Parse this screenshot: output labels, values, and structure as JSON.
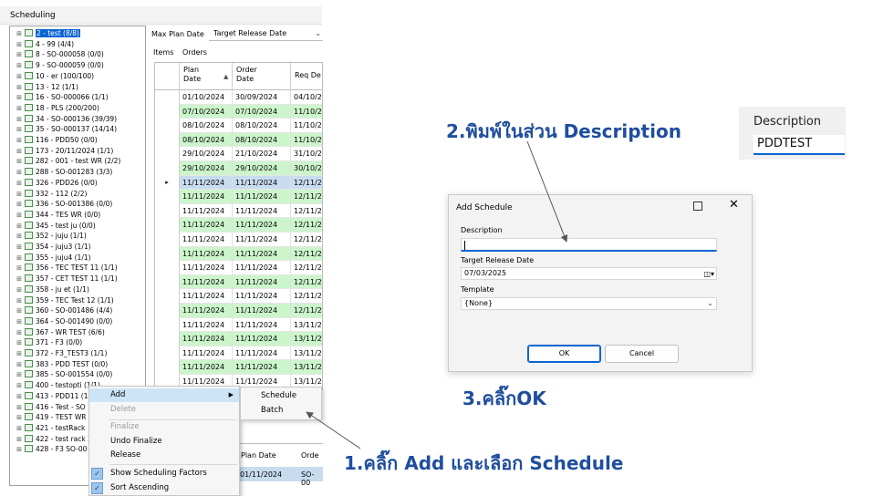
{
  "app": {
    "title": "Scheduling",
    "tree_items": [
      "2 - test (8/8)",
      "4 - 99 (4/4)",
      "8 - SO-000058 (0/0)",
      "9 - SO-000059 (0/0)",
      "10 - er (100/100)",
      "13 - 12 (1/1)",
      "16 - SO-000066 (1/1)",
      "18 - PLS (200/200)",
      "34 - SO-000136 (39/39)",
      "35 - SO-000137 (14/14)",
      "116 - PDD50 (0/0)",
      "173 - 20/11/2024 (1/1)",
      "282 - 001 - test WR (2/2)",
      "288 - SO-001283 (3/3)",
      "326 - PDD26 (0/0)",
      "332 - 112 (2/2)",
      "336 - SO-001386 (0/0)",
      "344 - TES WR (0/0)",
      "345 - test ju (0/0)",
      "352 - juju (1/1)",
      "354 - juju3 (1/1)",
      "355 - juju4 (1/1)",
      "356 - TEC TEST 11 (1/1)",
      "357 - CET TEST 11 (1/1)",
      "358 - ju et (1/1)",
      "359 - TEC Test 12 (1/1)",
      "360 - SO-001486 (4/4)",
      "364 - SO-001490 (0/0)",
      "367 - WR TEST (6/6)",
      "371 - F3 (0/0)",
      "372 - F3_TEST3 (1/1)",
      "383 - PDD TEST (0/0)",
      "385 - SO-001554 (0/0)",
      "400 - testopti (1/1)",
      "413 - PDD11 (1",
      "416 - Test - SO",
      "419 - TEST WR",
      "421 - testRack",
      "422 - test rack 2",
      "428 - F3 SO-00"
    ],
    "filter_label": "Max Plan Date",
    "filter_value": "Target Release Date",
    "grid_tabs": [
      "Items",
      "Orders"
    ],
    "grid_headers": [
      "Plan\nDate",
      "Order\nDate",
      "Req De"
    ],
    "grid_rows": [
      [
        "01/10/2024",
        "30/09/2024",
        "04/10/2"
      ],
      [
        "07/10/2024",
        "07/10/2024",
        "11/10/2"
      ],
      [
        "08/10/2024",
        "08/10/2024",
        "11/10/2"
      ],
      [
        "08/10/2024",
        "08/10/2024",
        "11/10/2"
      ],
      [
        "29/10/2024",
        "21/10/2024",
        "31/10/2"
      ],
      [
        "29/10/2024",
        "29/10/2024",
        "30/10/2"
      ],
      [
        "11/11/2024",
        "11/11/2024",
        "12/11/2"
      ],
      [
        "11/11/2024",
        "11/11/2024",
        "12/11/2"
      ],
      [
        "11/11/2024",
        "11/11/2024",
        "12/11/2"
      ],
      [
        "11/11/2024",
        "11/11/2024",
        "12/11/2"
      ],
      [
        "11/11/2024",
        "11/11/2024",
        "12/11/2"
      ],
      [
        "11/11/2024",
        "11/11/2024",
        "12/11/2"
      ],
      [
        "11/11/2024",
        "11/11/2024",
        "12/11/2"
      ],
      [
        "11/11/2024",
        "11/11/2024",
        "12/11/2"
      ],
      [
        "11/11/2024",
        "11/11/2024",
        "12/11/2"
      ],
      [
        "11/11/2024",
        "11/11/2024",
        "12/11/2"
      ],
      [
        "11/11/2024",
        "11/11/2024",
        "13/11/2"
      ],
      [
        "11/11/2024",
        "11/11/2024",
        "13/11/2"
      ],
      [
        "11/11/2024",
        "11/11/2024",
        "13/11/2"
      ],
      [
        "11/11/2024",
        "11/11/2024",
        "13/11/2"
      ],
      [
        "11/11/2024",
        "11/11/2024",
        "13/11/2"
      ],
      [
        "11/11/2024",
        "11/11/2024",
        "13/11/2"
      ],
      [
        "11/11/2024",
        "11/11/2024",
        "13/11/2"
      ]
    ],
    "row_colors": {
      "green": "#ccf5cc",
      "selected": "#c8dcf0",
      "white": "#ffffff"
    },
    "lower_grid": {
      "headers": [
        "Plan Date",
        "Orde"
      ],
      "row": [
        "01/11/2024",
        "SO-00"
      ]
    }
  },
  "context_menu": {
    "items": [
      {
        "label": "Add",
        "state": "highlighted",
        "submenu": true
      },
      {
        "label": "Delete",
        "state": "disabled"
      },
      {
        "label": "Finalize",
        "state": "disabled"
      },
      {
        "label": "Undo Finalize",
        "state": "normal"
      },
      {
        "label": "Release",
        "state": "normal"
      },
      {
        "label": "Show Scheduling Factors",
        "state": "checked"
      },
      {
        "label": "Sort Ascending",
        "state": "checked"
      }
    ],
    "submenu_items": [
      "Schedule",
      "Batch"
    ]
  },
  "annotations": {
    "step1": "1.คลิ๊ก Add และเลือก Schedule",
    "step2": "2.พิมพ์ในส่วน Description",
    "step3": "3.คลิ๊กOK"
  },
  "zoom": {
    "label": "Description",
    "value": "PDDTEST"
  },
  "dialog": {
    "title": "Add Schedule",
    "description_label": "Description",
    "description_value": "",
    "target_release_label": "Target Release Date",
    "target_release_value": "07/03/2025",
    "template_label": "Template",
    "template_value": "{None}",
    "ok_label": "OK",
    "cancel_label": "Cancel"
  },
  "colors": {
    "annotation": "#1f4e9e",
    "accent": "#0a64d2"
  }
}
